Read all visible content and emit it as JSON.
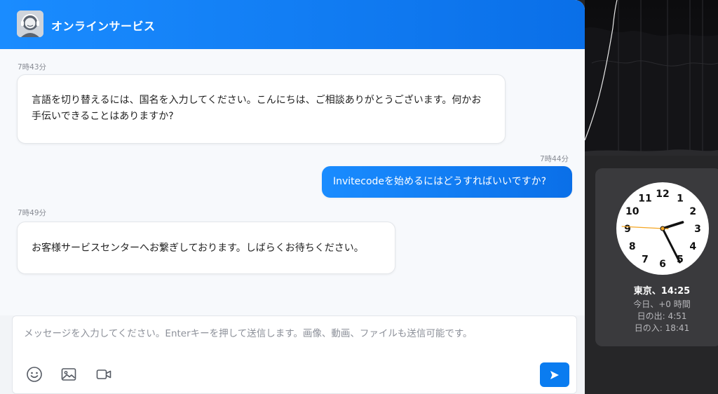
{
  "chat": {
    "title": "オンラインサービス",
    "avatar_icon": "customer-support-avatar",
    "accent_color": "#0a7cf0",
    "messages": [
      {
        "time": "7時43分",
        "side": "left",
        "text": "言語を切り替えるには、国名を入力してください。こんにちは、ご相談ありがとうございます。何かお手伝いできることはありますか?"
      },
      {
        "time": "7時44分",
        "side": "right",
        "text": "Invitecodeを始めるにはどうすればいいですか?"
      },
      {
        "time": "7時49分",
        "side": "left",
        "text": "お客様サービスセンターへお繋ぎしております。しばらくお待ちください。"
      }
    ],
    "input": {
      "value": "",
      "placeholder": "メッセージを入力してください。Enterキーを押して送信します。画像、動画、ファイルも送信可能です。"
    },
    "toolbar": {
      "emoji_icon": "emoji-icon",
      "image_icon": "image-icon",
      "video_icon": "video-camera-icon",
      "send_icon": "send-icon"
    }
  },
  "world_clock": {
    "city_time": "東京、14:25",
    "offset": "今日、+0 時間",
    "sunrise": "日の出: 4:51",
    "sunset": "日の入: 18:41",
    "numerals": [
      "12",
      "1",
      "2",
      "3",
      "4",
      "5",
      "6",
      "7",
      "8",
      "9",
      "10",
      "11"
    ],
    "second_hand_color": "#f5a623"
  }
}
